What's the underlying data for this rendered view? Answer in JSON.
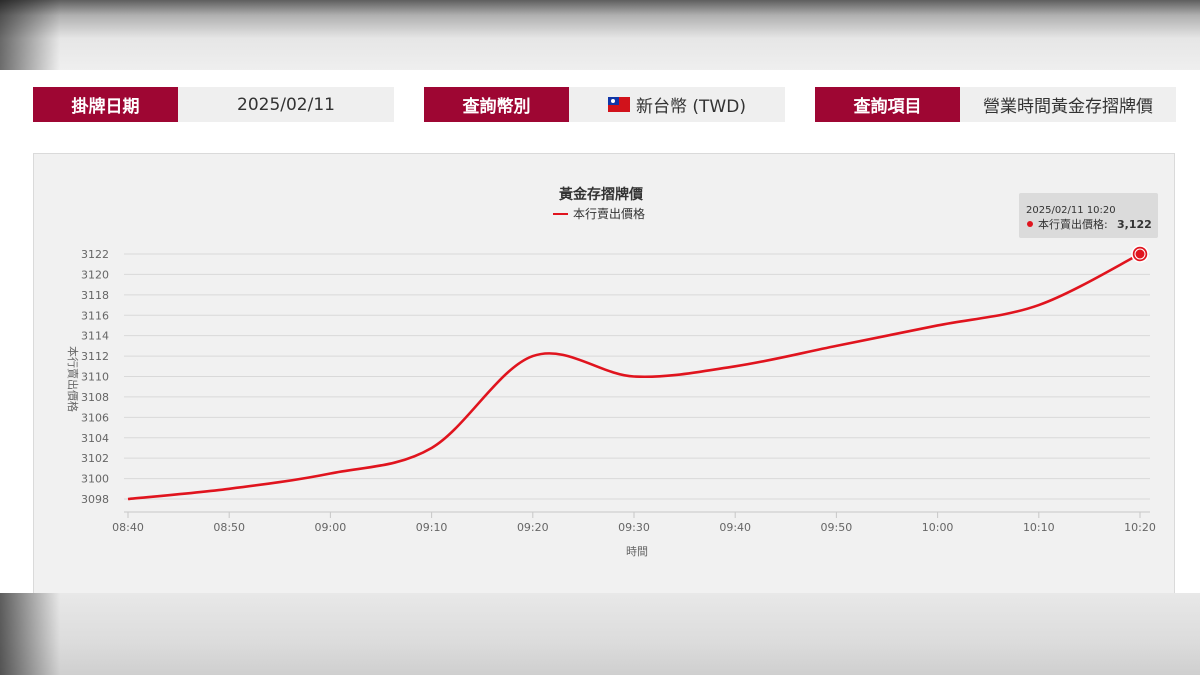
{
  "filters": [
    {
      "label": "掛牌日期",
      "value": "2025/02/11"
    },
    {
      "label": "查詢幣別",
      "value": "新台幣 (TWD)",
      "flag_icon": "taiwan-flag-icon"
    },
    {
      "label": "查詢項目",
      "value": "營業時間黃金存摺牌價"
    }
  ],
  "colors": {
    "accent": "#9e0633",
    "line": "#e0141e"
  },
  "chart_data": {
    "type": "line",
    "title": "黃金存摺牌價",
    "xlabel": "時間",
    "ylabel": "本行賣出價格",
    "legend_position": "top-center",
    "grid": true,
    "categories": [
      "08:40",
      "08:50",
      "09:00",
      "09:10",
      "09:20",
      "09:30",
      "09:40",
      "09:50",
      "10:00",
      "10:10",
      "10:20"
    ],
    "y_ticks": [
      3098,
      3100,
      3102,
      3104,
      3106,
      3108,
      3110,
      3112,
      3114,
      3116,
      3118,
      3120,
      3122
    ],
    "ylim": [
      3098,
      3122
    ],
    "series": [
      {
        "name": "本行賣出價格",
        "values": [
          3098,
          3099,
          3100.5,
          3103,
          3112,
          3110,
          3111,
          3113,
          3115,
          3117,
          3122
        ]
      }
    ],
    "tooltip": {
      "date": "2025/02/11 10:20",
      "series": "本行賣出價格:",
      "value": "3,122"
    }
  }
}
